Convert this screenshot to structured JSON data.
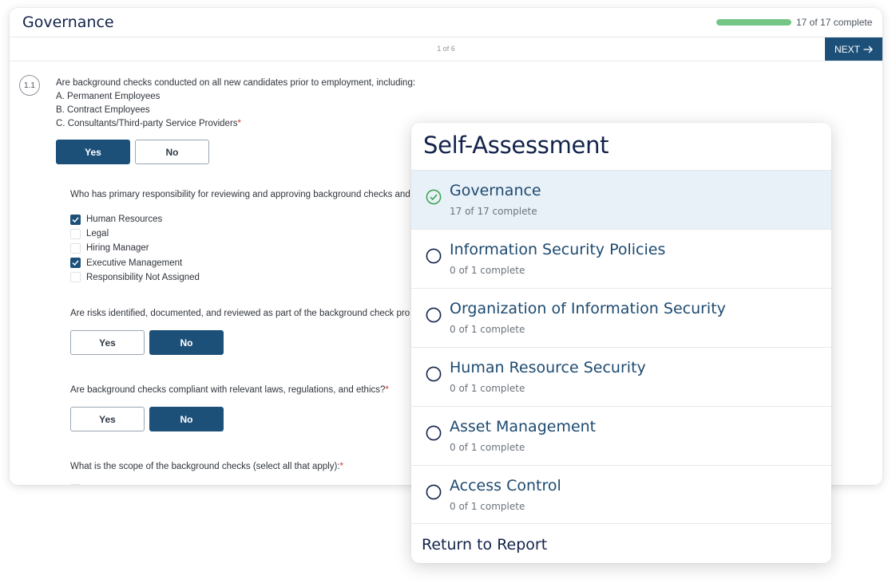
{
  "questionnaire": {
    "title": "Governance",
    "progress_fraction": 1.0,
    "progress_text": "17 of 17 complete",
    "page_indicator": "1 of 6",
    "next_label": "NEXT",
    "question_number": "1.1",
    "q1": {
      "lines": [
        "Are background checks conducted on all new candidates prior to employment, including:",
        "A. Permanent Employees",
        "B. Contract Employees",
        "C. Consultants/Third-party Service Providers"
      ],
      "required_mark": "*",
      "yes_label": "Yes",
      "no_label": "No",
      "selected": "Yes"
    },
    "q2": {
      "text": "Who has primary responsibility for reviewing and approving background checks and",
      "options": [
        {
          "label": "Human Resources",
          "checked": true
        },
        {
          "label": "Legal",
          "checked": false
        },
        {
          "label": "Hiring Manager",
          "checked": false
        },
        {
          "label": "Executive Management",
          "checked": true
        },
        {
          "label": "Responsibility Not Assigned",
          "checked": false
        }
      ]
    },
    "q3": {
      "text": "Are risks identified, documented, and reviewed as part of the background check pro",
      "yes_label": "Yes",
      "no_label": "No",
      "selected": "No"
    },
    "q4": {
      "text": "Are background checks compliant with relevant laws, regulations, and ethics?",
      "required_mark": "*",
      "yes_label": "Yes",
      "no_label": "No",
      "selected": "No"
    },
    "q5": {
      "text": "What is the scope of the background checks (select all that apply):",
      "required_mark": "*"
    }
  },
  "panel": {
    "title": "Self-Assessment",
    "sections": [
      {
        "name": "Governance",
        "count": "17 of 17 complete",
        "complete": true,
        "active": true
      },
      {
        "name": "Information Security Policies",
        "count": "0 of 1 complete",
        "complete": false,
        "active": false
      },
      {
        "name": "Organization of Information Security",
        "count": "0 of 1 complete",
        "complete": false,
        "active": false
      },
      {
        "name": "Human Resource Security",
        "count": "0 of 1 complete",
        "complete": false,
        "active": false
      },
      {
        "name": "Asset Management",
        "count": "0 of 1 complete",
        "complete": false,
        "active": false
      },
      {
        "name": "Access Control",
        "count": "0 of 1 complete",
        "complete": false,
        "active": false
      }
    ],
    "return_label": "Return to Report"
  },
  "colors": {
    "primary": "#1d5079",
    "title_navy": "#12224a",
    "progress_green": "#74c686",
    "check_green": "#3aa14e",
    "active_row": "#e9f1f8",
    "required_red": "#d6392f"
  },
  "icons": {
    "next": "arrow-right-icon",
    "section_complete": "check-circle-icon",
    "section_incomplete": "empty-circle-icon",
    "checkbox_checked": "checkmark-icon"
  }
}
